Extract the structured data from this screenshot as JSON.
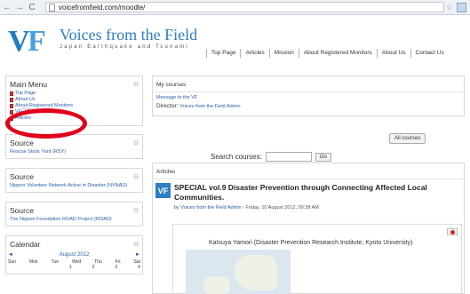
{
  "browser": {
    "url": "voicefromfield.com/moodle/"
  },
  "header": {
    "logo_title": "Voices from the Field",
    "logo_subtitle": "Japan Earthquake and Tsunami",
    "nav": [
      "Top Page",
      "Articles",
      "Mission",
      "About Registered Monitors",
      "About Us",
      "Contact Us"
    ]
  },
  "sidebar": {
    "main_menu": {
      "title": "Main Menu",
      "items": [
        "Top Page",
        "About Us",
        "About Registered Monitors",
        "VF口座",
        "Articles"
      ]
    },
    "sources": [
      {
        "title": "Source",
        "link": "Rescue Stock Yard (RSY)"
      },
      {
        "title": "Source",
        "link": "Nippon Volunteer Network Active in Disaster (NVNAD)"
      },
      {
        "title": "Source",
        "link": "The Nippon Foundation ROAD Project (ROAD)"
      }
    ],
    "calendar": {
      "title": "Calendar",
      "month": "August 2012",
      "prev": "◄",
      "next": "►",
      "days": [
        "Sun",
        "Mon",
        "Tue",
        "Wed",
        "Thu",
        "Fri",
        "Sat"
      ],
      "first_week": [
        "",
        "",
        "",
        "1",
        "2",
        "3",
        "4"
      ]
    }
  },
  "main": {
    "my_courses": "My courses",
    "course_link": "Message to the VF",
    "director_label": "Director:",
    "director_name": "Voices from the Field Admin",
    "all_courses": "All courses",
    "search_label": "Search courses:",
    "go_label": "Go",
    "articles_title": "Articles",
    "post": {
      "title": "SPECIAL vol.9 Disaster Prevention through Connecting Affected Local Communities.",
      "by": "by",
      "author_link": "Voices from the Field Admin",
      "date": "- Friday, 10 August 2012, 09:38 AM",
      "author_line": "Katsuya Yamori (Disaster Prevention Research Institute, Kyoto University)"
    }
  },
  "colors": {
    "accent": "#2c7fc2",
    "link": "#2a5da8",
    "highlight_oval": "#e0001a"
  }
}
